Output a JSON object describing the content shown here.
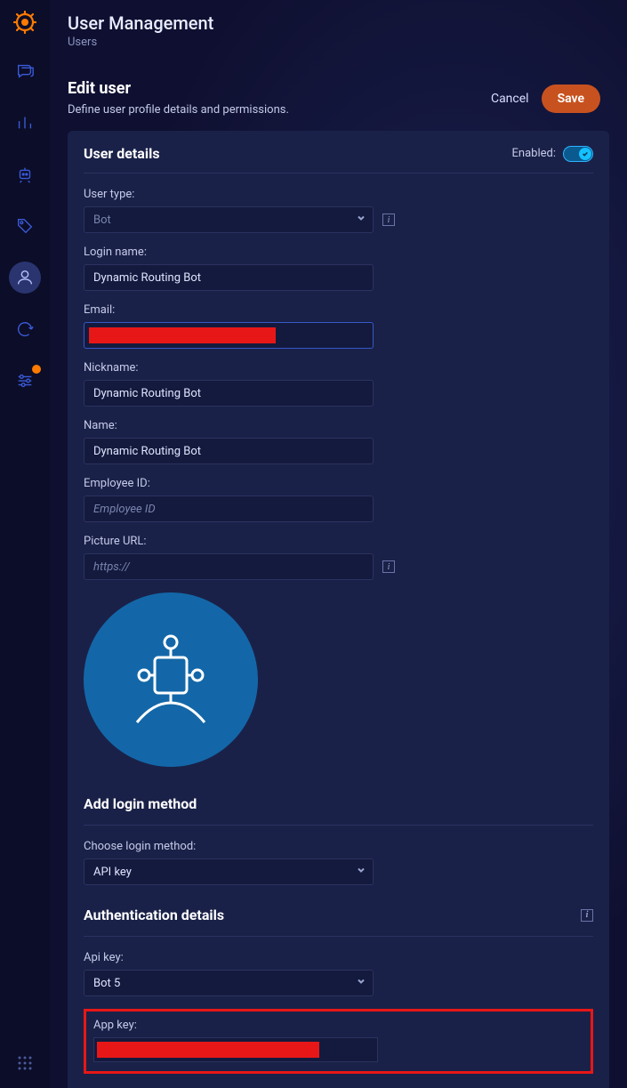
{
  "header": {
    "title": "User Management",
    "breadcrumb": "Users"
  },
  "editbar": {
    "title": "Edit user",
    "subtitle": "Define user profile details and permissions.",
    "cancel": "Cancel",
    "save": "Save"
  },
  "user_details": {
    "section_title": "User details",
    "enabled_label": "Enabled:",
    "enabled": true,
    "fields": {
      "user_type": {
        "label": "User type:",
        "value": "Bot"
      },
      "login_name": {
        "label": "Login name:",
        "value": "Dynamic Routing Bot"
      },
      "email": {
        "label": "Email:",
        "value": ""
      },
      "nickname": {
        "label": "Nickname:",
        "value": "Dynamic Routing Bot"
      },
      "name": {
        "label": "Name:",
        "value": "Dynamic Routing Bot"
      },
      "employee_id": {
        "label": "Employee ID:",
        "placeholder": "Employee ID",
        "value": ""
      },
      "picture_url": {
        "label": "Picture URL:",
        "placeholder": "https://",
        "value": ""
      }
    }
  },
  "login_method": {
    "section_title": "Add login method",
    "choose_label": "Choose login method:",
    "value": "API key"
  },
  "auth": {
    "section_title": "Authentication details",
    "api_key": {
      "label": "Api key:",
      "value": "Bot 5"
    },
    "app_key": {
      "label": "App key:",
      "value": ""
    }
  },
  "sidebar_icons": [
    "chat",
    "analytics",
    "bot",
    "tag",
    "users",
    "refresh",
    "settings"
  ],
  "sidebar_active_index": 4
}
